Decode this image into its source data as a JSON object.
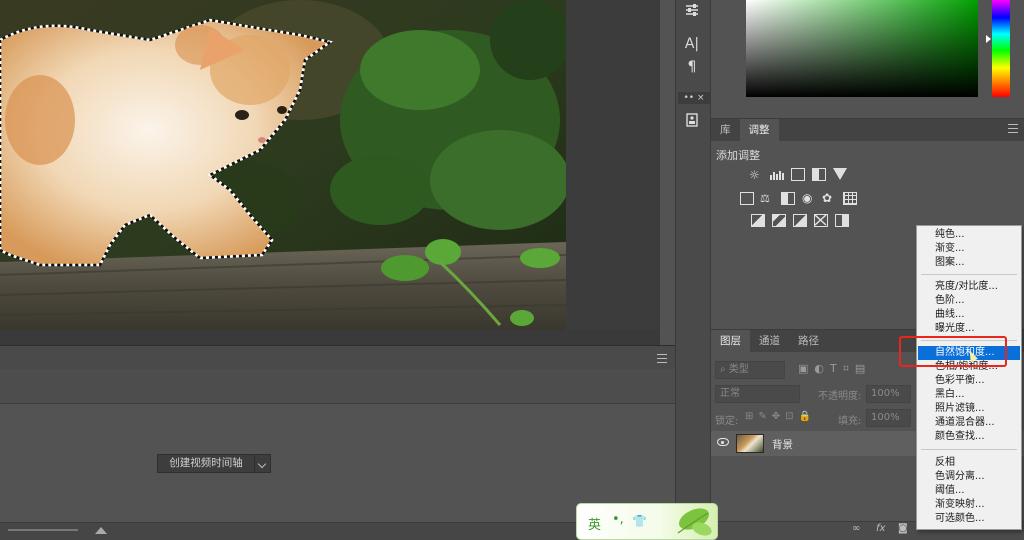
{
  "image": {
    "subject": "kitten-on-log"
  },
  "timeline": {
    "create_video_button": "创建视频时间轴"
  },
  "tool_strip": {
    "icons": [
      "sliders-icon",
      "character-icon",
      "paragraph-icon",
      "collapse-icon",
      "properties-icon"
    ],
    "char_label": "A|",
    "para_label": "¶",
    "collapse_label": "•• ×"
  },
  "adjustments": {
    "tabs": [
      {
        "label": "库",
        "active": false
      },
      {
        "label": "调整",
        "active": true
      }
    ],
    "title": "添加调整"
  },
  "layers": {
    "tabs": [
      {
        "label": "图层",
        "active": true
      },
      {
        "label": "通道",
        "active": false
      },
      {
        "label": "路径",
        "active": false
      }
    ],
    "kind_filter": "类型",
    "blend_mode": "正常",
    "opacity_label": "不透明度:",
    "opacity_value": "100%",
    "lock_label": "锁定:",
    "fill_label": "填充:",
    "fill_value": "100%",
    "layer_name": "背景",
    "footer_icons": [
      "link-icon",
      "fx-icon",
      "mask-icon"
    ],
    "footer_fx": "fx"
  },
  "adjustment_menu": {
    "items": [
      {
        "label": "纯色...",
        "selected": false
      },
      {
        "label": "渐变...",
        "selected": false
      },
      {
        "label": "图案...",
        "selected": false
      },
      {
        "label": "亮度/对比度...",
        "selected": false
      },
      {
        "label": "色阶...",
        "selected": false
      },
      {
        "label": "曲线...",
        "selected": false
      },
      {
        "label": "曝光度...",
        "selected": false
      },
      {
        "label": "自然饱和度...",
        "selected": true
      },
      {
        "label": "色相/饱和度...",
        "selected": false
      },
      {
        "label": "色彩平衡...",
        "selected": false
      },
      {
        "label": "黑白...",
        "selected": false
      },
      {
        "label": "照片滤镜...",
        "selected": false
      },
      {
        "label": "通道混合器...",
        "selected": false
      },
      {
        "label": "颜色查找...",
        "selected": false
      },
      {
        "label": "反相",
        "selected": false
      },
      {
        "label": "色调分离...",
        "selected": false
      },
      {
        "label": "阈值...",
        "selected": false
      },
      {
        "label": "渐变映射...",
        "selected": false
      },
      {
        "label": "可选颜色...",
        "selected": false
      }
    ],
    "highlight_color": "#e8261e",
    "selection_color": "#0a6fd8"
  },
  "ime": {
    "mode_char": "英",
    "punct": "•,",
    "skin_icon": "shirt-icon"
  },
  "colors": {
    "workspace": "#535353",
    "color_field_hue": "#00a000"
  }
}
